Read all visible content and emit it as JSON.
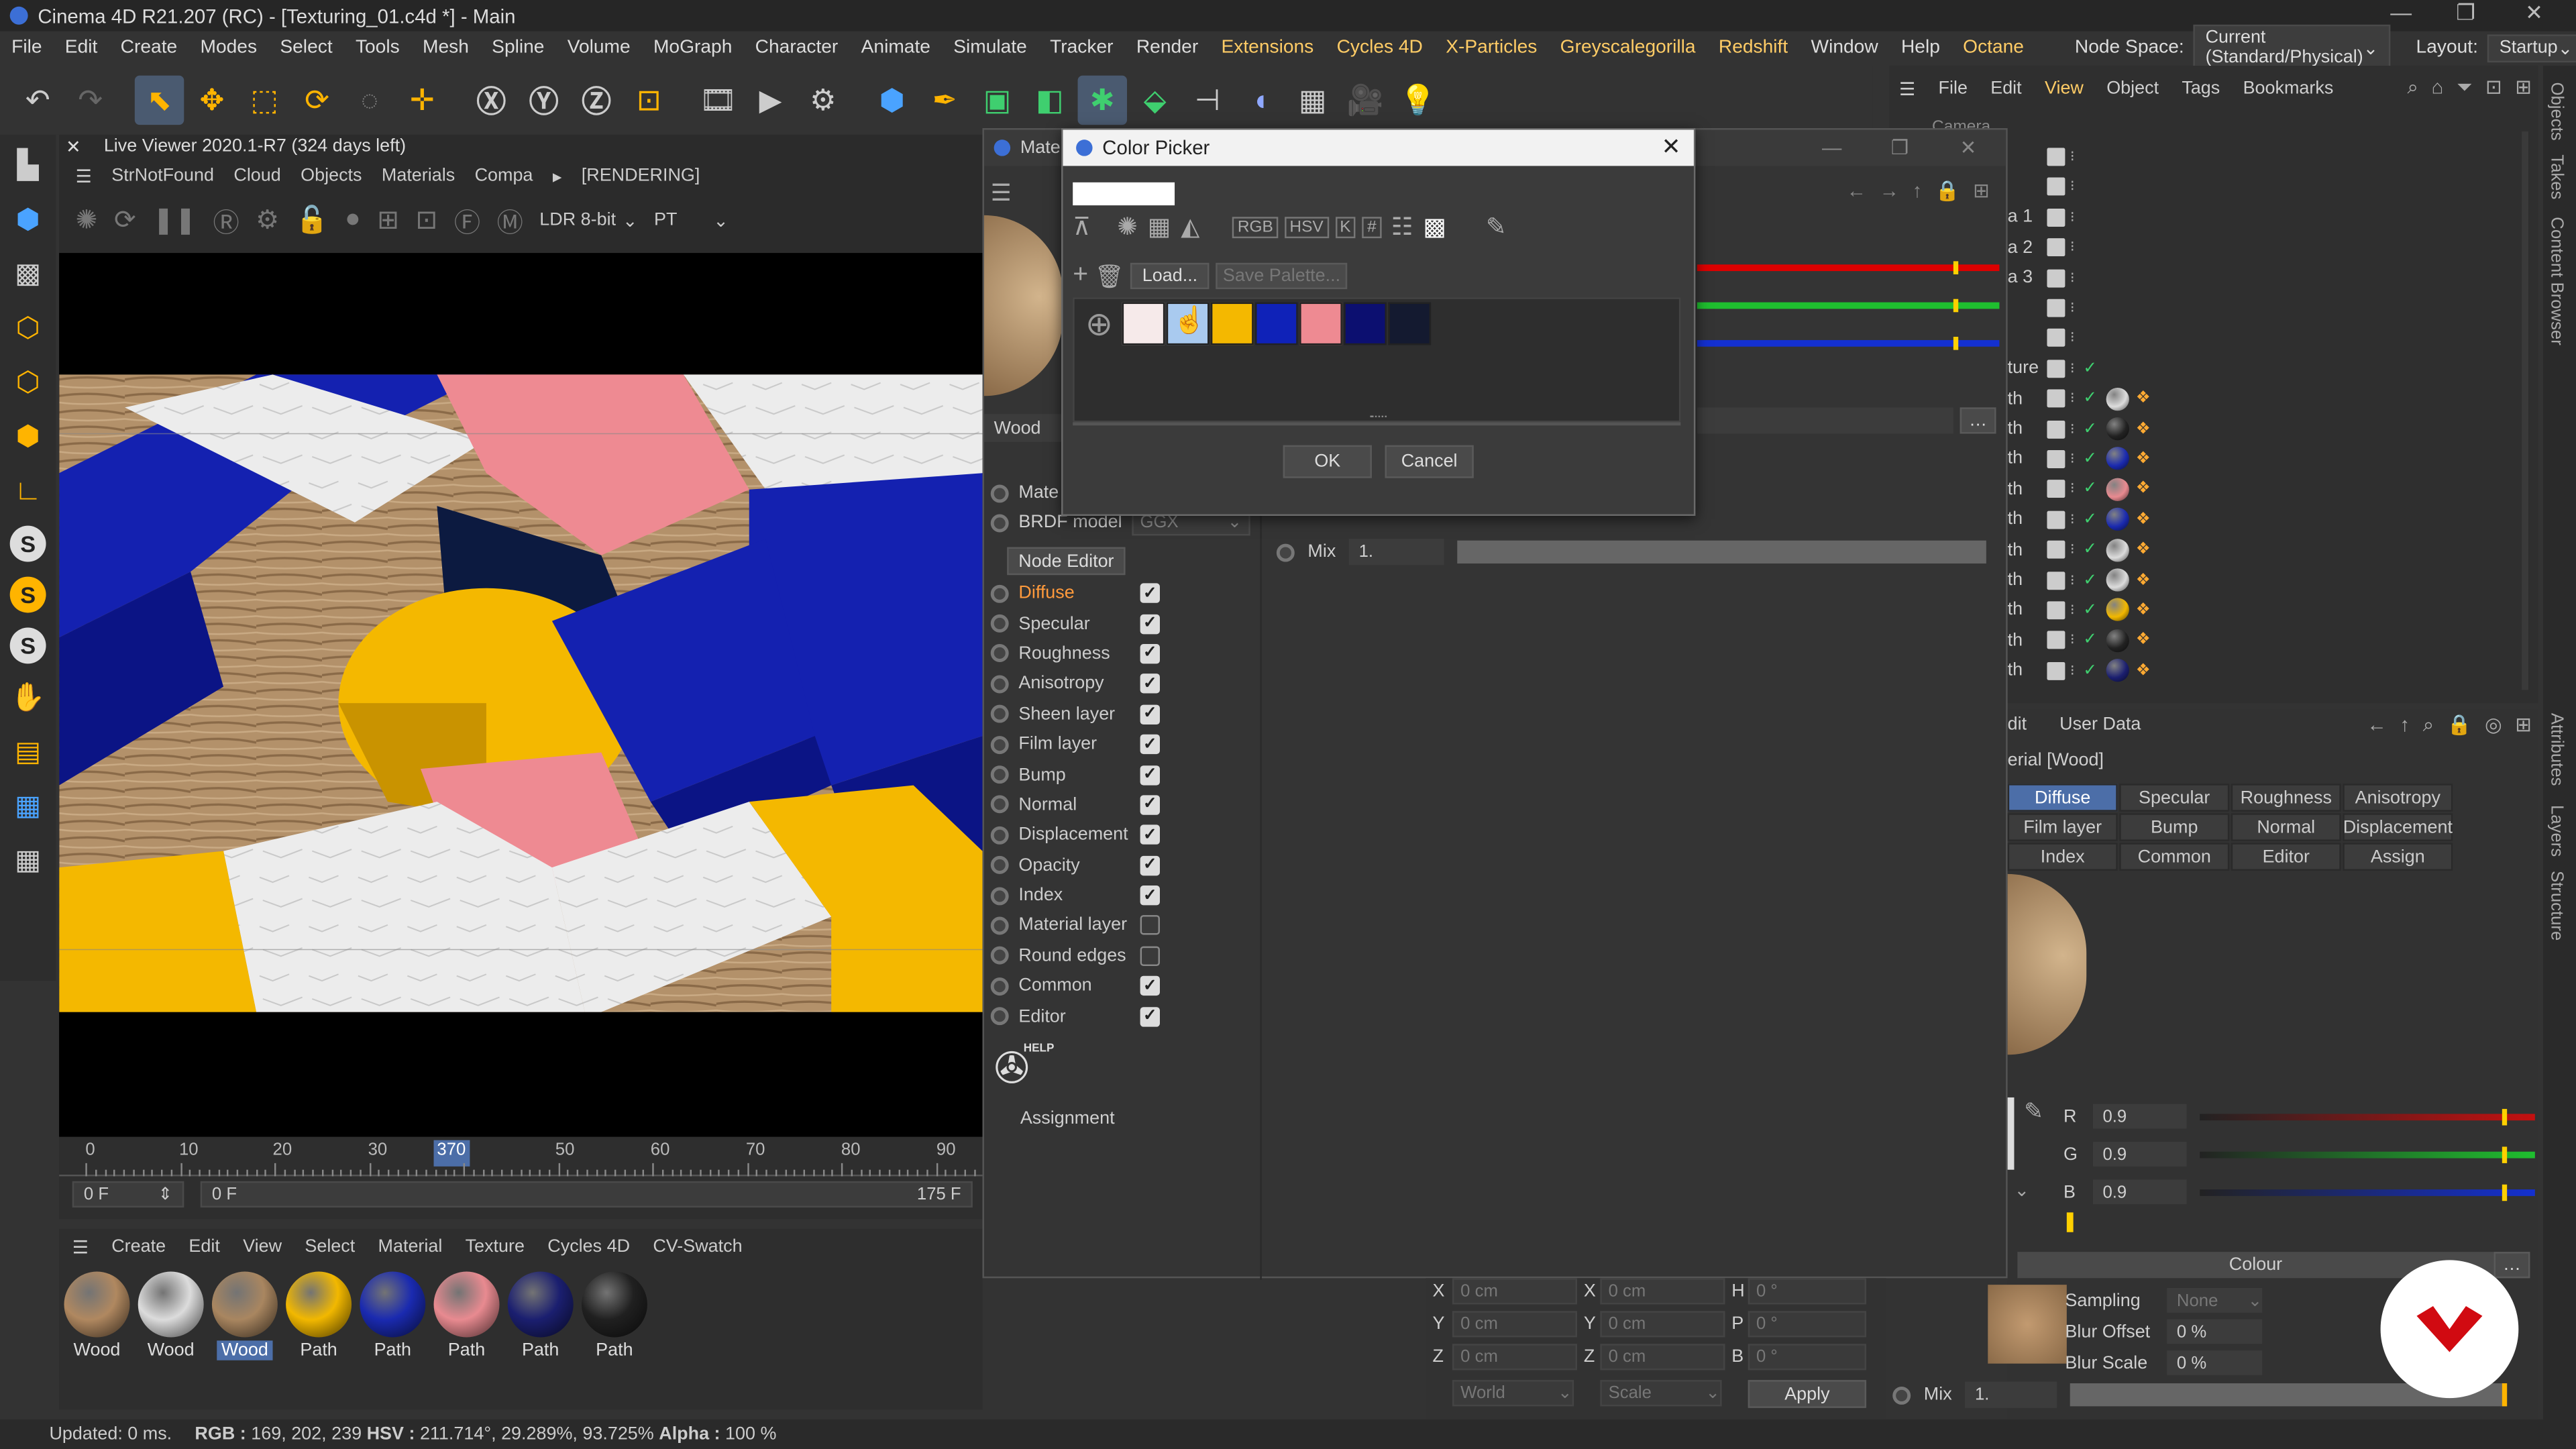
{
  "window": {
    "title": "Cinema 4D R21.207 (RC) - [Texturing_01.c4d *] - Main",
    "minimize": "—",
    "restore": "❐",
    "close": "✕"
  },
  "menu": {
    "items": [
      "File",
      "Edit",
      "Create",
      "Modes",
      "Select",
      "Tools",
      "Mesh",
      "Spline",
      "Volume",
      "MoGraph",
      "Character",
      "Animate",
      "Simulate",
      "Tracker",
      "Render",
      "Extensions",
      "Cycles 4D",
      "X-Particles",
      "Greyscalegorilla",
      "Redshift",
      "Window",
      "Help",
      "Octane"
    ],
    "node_space_label": "Node Space:",
    "node_space_value": "Current (Standard/Physical)",
    "layout_label": "Layout:",
    "layout_value": "Startup"
  },
  "viewer": {
    "title": "Live Viewer 2020.1-R7 (324 days left)",
    "menu": [
      "StrNotFound",
      "Cloud",
      "Objects",
      "Materials",
      "Compa"
    ],
    "rendering": "[RENDERING]",
    "depth": "LDR 8-bit",
    "mode": "PT"
  },
  "timeline": {
    "ticks": [
      "0",
      "10",
      "20",
      "30",
      "50",
      "60",
      "70",
      "80",
      "90"
    ],
    "current": "370",
    "start_frame": "0 F",
    "current_frame": "0 F",
    "end_frame": "175 F"
  },
  "material_manager": {
    "menu": [
      "Create",
      "Edit",
      "View",
      "Select",
      "Material",
      "Texture",
      "Cycles 4D",
      "CV-Swatch"
    ],
    "materials": [
      {
        "label": "Wood",
        "color": "#b08860"
      },
      {
        "label": "Wood",
        "color": "#dcdcdc"
      },
      {
        "label": "Wood",
        "color": "#a98660",
        "selected": true
      },
      {
        "label": "Path",
        "color": "#f2b800"
      },
      {
        "label": "Path",
        "color": "#1a2ab0"
      },
      {
        "label": "Path",
        "color": "#e88a90"
      },
      {
        "label": "Path",
        "color": "#1b1f70"
      },
      {
        "label": "Path",
        "color": "#202020"
      }
    ]
  },
  "status": {
    "updated": "Updated: 0 ms.",
    "rgb_label": "RGB :",
    "rgb": "169, 202, 239",
    "hsv_label": "HSV :",
    "hsv": "211.714°, 29.289%, 93.725%",
    "alpha_label": "Alpha :",
    "alpha": "100 %"
  },
  "material_editor": {
    "title": "Mate",
    "material_name": "Wood",
    "material_label": "Mate",
    "brdf_label": "BRDF model",
    "brdf_value": "GGX",
    "node_editor": "Node Editor",
    "channels": [
      {
        "label": "Diffuse",
        "checked": true,
        "active": true
      },
      {
        "label": "Specular",
        "checked": true
      },
      {
        "label": "Roughness",
        "checked": true
      },
      {
        "label": "Anisotropy",
        "checked": true
      },
      {
        "label": "Sheen layer",
        "checked": true
      },
      {
        "label": "Film layer",
        "checked": true
      },
      {
        "label": "Bump",
        "checked": true
      },
      {
        "label": "Normal",
        "checked": true
      },
      {
        "label": "Displacement",
        "checked": true
      },
      {
        "label": "Opacity",
        "checked": true
      },
      {
        "label": "Index",
        "checked": true
      },
      {
        "label": "Material layer",
        "checked": false
      },
      {
        "label": "Round edges",
        "checked": false
      },
      {
        "label": "Common",
        "checked": true
      },
      {
        "label": "Editor",
        "checked": true
      }
    ],
    "help": "HELP",
    "assignment": "Assignment",
    "blur_scale": "Blur Scale",
    "mix_label": "Mix",
    "mix_value": "1."
  },
  "color_picker": {
    "title": "Color Picker",
    "load": "Load...",
    "save_palette": "Save Palette...",
    "modes": [
      "RGB",
      "HSV",
      "K",
      "#"
    ],
    "swatches": [
      "#f6eaea",
      "#a9caef",
      "#f4b800",
      "#0f22b8",
      "#ee8a92",
      "#0c0f70",
      "#141a30"
    ],
    "ok": "OK",
    "cancel": "Cancel"
  },
  "objects_panel": {
    "menu": [
      "File",
      "Edit",
      "View",
      "Object",
      "Tags",
      "Bookmarks"
    ],
    "first_row": "Camera",
    "rows": [
      "",
      "",
      "a 1",
      "a 2",
      "a 3",
      "",
      "",
      "ture",
      "th",
      "th",
      "th",
      "th",
      "th",
      "th",
      "th",
      "th",
      "th",
      "th"
    ],
    "tag_colors": [
      "",
      "",
      "",
      "",
      "",
      "",
      "",
      "",
      "#ddd",
      "#222",
      "#1a2ab0",
      "#e88a90",
      "#1a2ab0",
      "#dcdcdc",
      "#dcdcdc",
      "#f2b800",
      "#222",
      "#1b1f70"
    ]
  },
  "attributes": {
    "header": "dit",
    "user_data": "User Data",
    "material": "erial [Wood]",
    "tabs": [
      {
        "label": "Diffuse",
        "active": true
      },
      {
        "label": "Specular"
      },
      {
        "label": "Roughness"
      },
      {
        "label": "Anisotropy"
      },
      {
        "label": "Film layer"
      },
      {
        "label": "Bump"
      },
      {
        "label": "Normal"
      },
      {
        "label": "Displacement"
      },
      {
        "label": "Index"
      },
      {
        "label": "Common"
      },
      {
        "label": "Editor"
      },
      {
        "label": "Assign"
      }
    ],
    "r_label": "R",
    "r_value": "0.9",
    "r_level": 0.9,
    "g_label": "G",
    "g_value": "0.9",
    "g_level": 0.9,
    "b_label": "B",
    "b_value": "0.9",
    "b_level": 0.9,
    "colour": "Colour",
    "sampling_label": "Sampling",
    "sampling_value": "None",
    "blur_offset_label": "Blur Offset",
    "blur_offset_value": "0 %",
    "blur_scale_label": "Blur Scale",
    "blur_scale_value": "0 %",
    "mix_label": "Mix",
    "mix_value": "1."
  },
  "coords": {
    "x": "X",
    "y": "Y",
    "z": "Z",
    "h": "H",
    "p": "P",
    "b": "B",
    "pos": "0 cm",
    "rot": "0 °",
    "world": "World",
    "scale": "Scale",
    "apply": "Apply"
  },
  "right_tabs": [
    "Objects",
    "Takes",
    "Content Browser",
    "Attributes",
    "Layers",
    "Structure"
  ],
  "colors": {
    "accent": "#4c6ea8",
    "active_channel": "#ff9a3c",
    "brand": "#d10a11"
  }
}
